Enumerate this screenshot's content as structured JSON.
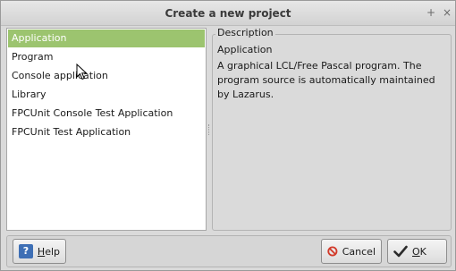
{
  "window": {
    "title": "Create a new project",
    "maximize_glyph": "+",
    "close_glyph": "×"
  },
  "project_list": {
    "selected_index": 0,
    "items": [
      "Application",
      "Program",
      "Console application",
      "Library",
      "FPCUnit Console Test Application",
      "FPCUnit Test Application"
    ]
  },
  "description": {
    "caption": "Description",
    "title": "Application",
    "text": "A graphical LCL/Free Pascal program. The program source is automatically maintained by Lazarus."
  },
  "buttons": {
    "help_accel": "H",
    "help_rest": "elp",
    "cancel_label": "Cancel",
    "ok_accel": "O",
    "ok_rest": "K"
  },
  "icons": {
    "help": "help-icon",
    "cancel": "cancel-icon",
    "ok": "checkmark-icon",
    "cursor": "mouse-pointer-icon"
  },
  "colors": {
    "selection": "#9cc46f",
    "help_icon": "#3e6fb5",
    "cancel_icon": "#d23a2a"
  }
}
